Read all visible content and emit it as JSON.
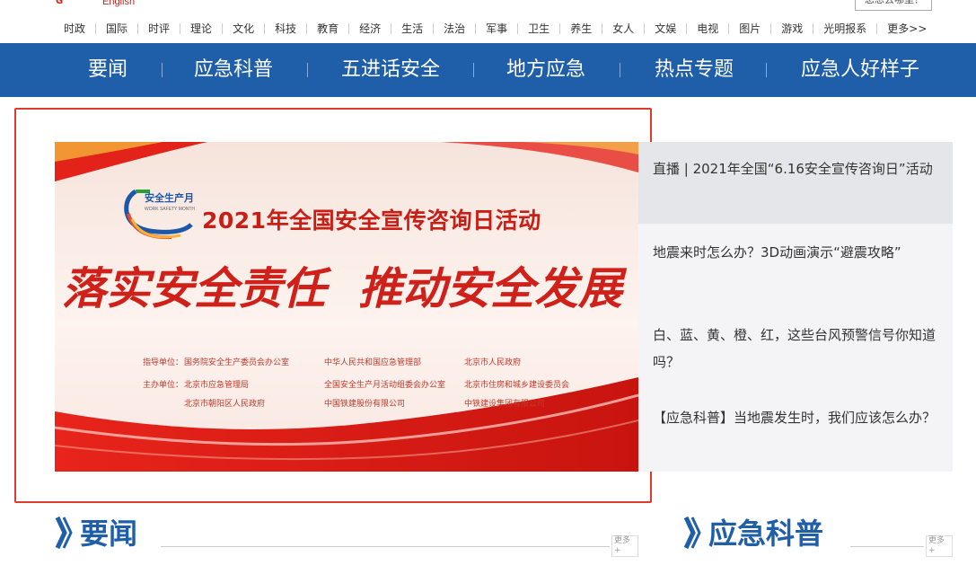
{
  "header": {
    "english_label": "English",
    "search_text": "您想去哪里？"
  },
  "categories": [
    "时政",
    "国际",
    "时评",
    "理论",
    "文化",
    "科技",
    "教育",
    "经济",
    "生活",
    "法治",
    "军事",
    "卫生",
    "养生",
    "女人",
    "文娱",
    "电视",
    "图片",
    "游戏",
    "光明报系",
    "更多>>"
  ],
  "main_nav": [
    "要闻",
    "应急科普",
    "五进话安全",
    "地方应急",
    "热点专题",
    "应急人好样子"
  ],
  "banner": {
    "logo_text": "安全生产月",
    "logo_sub": "WORK SAFETY MONTH",
    "headline": "2021年全国安全宣传咨询日活动",
    "slogan_left": "落实安全责任",
    "slogan_right": "推动安全发展",
    "credits": {
      "guide_label": "指导单位：",
      "host_label": "主办单位：",
      "guide": [
        "国务院安全生产委员会办公室",
        "中华人民共和国应急管理部",
        "北京市人民政府"
      ],
      "host_row1": [
        "北京市应急管理局",
        "全国安全生产月活动组委会办公室",
        "北京市住房和城乡建设委员会"
      ],
      "host_row2": [
        "北京市朝阳区人民政府",
        "中国铁建股份有限公司",
        "中铁建设集团有限公司"
      ]
    }
  },
  "news": [
    {
      "title": "直播 | 2021年全国“6.16安全宣传咨询日”活动"
    },
    {
      "title": "地震来时怎么办？3D动画演示“避震攻略”"
    },
    {
      "title": "白、蓝、黄、橙、红，这些台风预警信号你知道吗？"
    },
    {
      "title": "【应急科普】当地震发生时，我们应该怎么办？"
    }
  ],
  "sections": {
    "left_title": "要闻",
    "right_title": "应急科普",
    "more_label": "更多+"
  },
  "colors": {
    "nav_blue": "#1f5ea8",
    "frame_red": "#e03a2c",
    "slogan_red": "#d0201a"
  }
}
